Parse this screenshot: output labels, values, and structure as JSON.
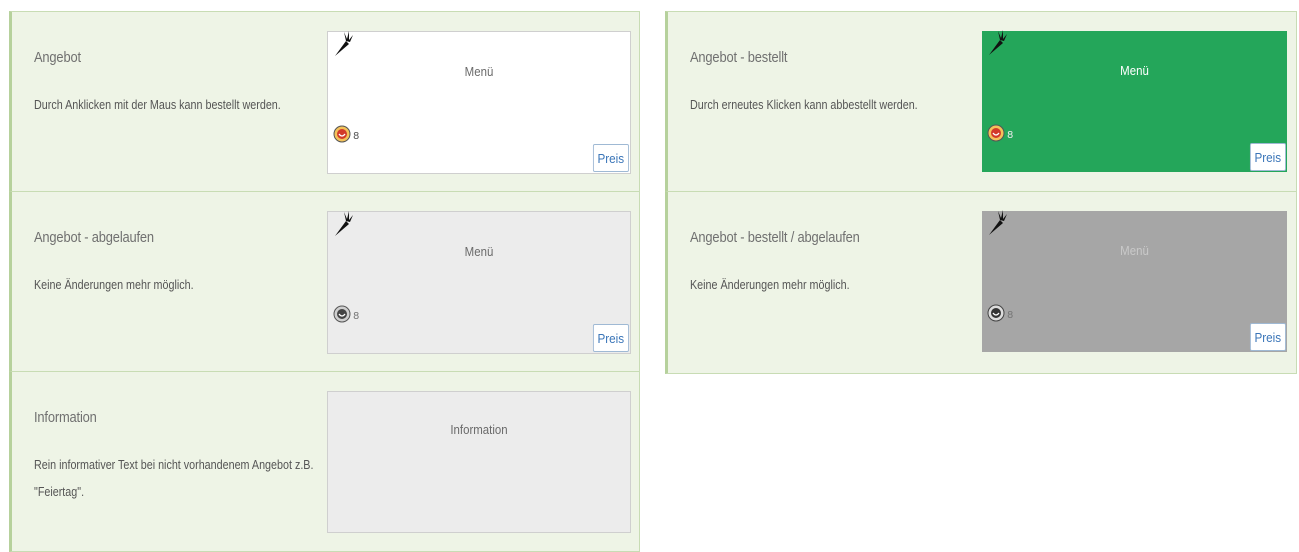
{
  "legend": {
    "left": [
      {
        "title": "Angebot",
        "description": "Durch Anklicken mit der Maus kann bestellt werden.",
        "tile": {
          "label": "Menü",
          "price_button": "Preis",
          "state": "offer",
          "color": "#ffffff"
        }
      },
      {
        "title": "Angebot - abgelaufen",
        "description": "Keine Änderungen mehr möglich.",
        "tile": {
          "label": "Menü",
          "price_button": "Preis",
          "state": "expired",
          "color": "#ececec"
        }
      },
      {
        "title": "Information",
        "description": "Rein informativer Text bei nicht vorhandenem Angebot z.B. \"Feiertag\".",
        "tile": {
          "label": "Information",
          "state": "information",
          "color": "#ececec"
        }
      }
    ],
    "right": [
      {
        "title": "Angebot - bestellt",
        "description": "Durch erneutes Klicken kann abbestellt werden.",
        "tile": {
          "label": "Menü",
          "price_button": "Preis",
          "state": "ordered",
          "color": "#24a65a"
        }
      },
      {
        "title": "Angebot - bestellt / abgelaufen",
        "description": "Keine Änderungen mehr möglich.",
        "tile": {
          "label": "Menü",
          "price_button": "Preis",
          "state": "ordered-expired",
          "color": "#a6a6a6"
        }
      }
    ]
  },
  "icons": {
    "vegetarian": "carrot-icon",
    "allergen": "allergen-badge-icon"
  },
  "colors": {
    "panel_background": "#eef4e6",
    "panel_border": "#c8dcb4",
    "ordered": "#24a65a",
    "ordered_expired": "#a6a6a6",
    "price_link": "#3a75b8"
  }
}
